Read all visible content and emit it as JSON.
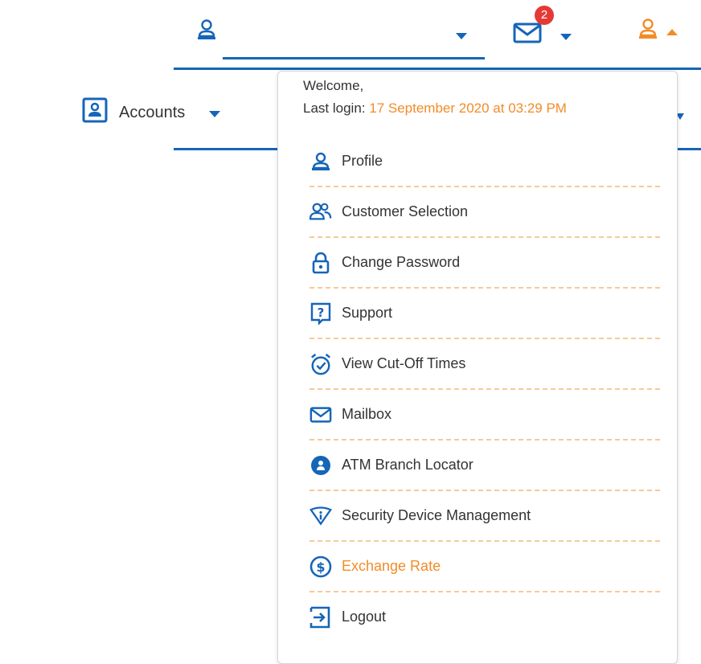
{
  "colors": {
    "primary": "#1565b8",
    "accent": "#f28c28",
    "badge": "#e53935",
    "separator": "#f6c99a"
  },
  "header": {
    "customer_select": {
      "icon": "user-icon",
      "value": ""
    },
    "mail": {
      "icon": "mail-icon",
      "badge_count": "2"
    },
    "user_menu": {
      "icon": "user-icon",
      "state": "expanded"
    }
  },
  "nav": {
    "accounts_label": "Accounts"
  },
  "dropdown": {
    "welcome": "Welcome,",
    "last_login_label": "Last login:",
    "last_login_value": "17 September 2020 at 03:29 PM",
    "items": [
      {
        "label": "Profile",
        "icon": "user-icon"
      },
      {
        "label": "Customer Selection",
        "icon": "users-icon"
      },
      {
        "label": "Change Password",
        "icon": "lock-icon"
      },
      {
        "label": "Support",
        "icon": "help-icon"
      },
      {
        "label": "View Cut-Off Times",
        "icon": "alarm-clock-icon"
      },
      {
        "label": "Mailbox",
        "icon": "mail-icon"
      },
      {
        "label": "ATM Branch Locator",
        "icon": "location-pin-icon"
      },
      {
        "label": "Security Device Management",
        "icon": "shield-icon"
      },
      {
        "label": "Exchange Rate",
        "icon": "dollar-icon",
        "highlight": true
      },
      {
        "label": "Logout",
        "icon": "logout-icon"
      }
    ]
  }
}
